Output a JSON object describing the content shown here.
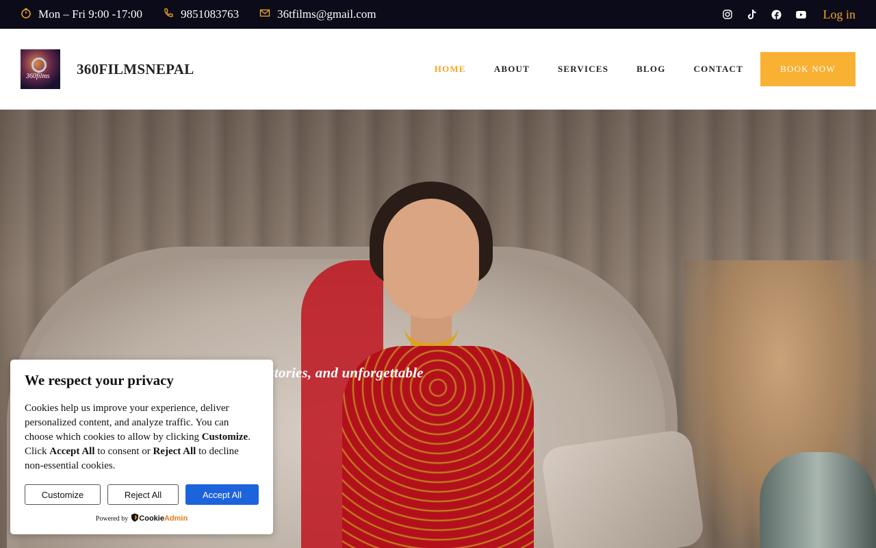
{
  "topbar": {
    "hours": "Mon – Fri 9:00 -17:00",
    "phone": "9851083763",
    "email": "36tfilms@gmail.com",
    "social_icons": [
      "instagram-icon",
      "tiktok-icon",
      "facebook-icon",
      "youtube-icon"
    ],
    "login": "Log in"
  },
  "header": {
    "logo_text": "360films",
    "brand": "360FILMSNEPAL",
    "nav": [
      {
        "label": "HOME",
        "active": true
      },
      {
        "label": "ABOUT",
        "active": false
      },
      {
        "label": "SERVICES",
        "active": false
      },
      {
        "label": "BLOG",
        "active": false
      },
      {
        "label": "CONTACT",
        "active": false
      }
    ],
    "book_button": "BOOK NOW"
  },
  "hero": {
    "text": "ve stories, and unforgettable"
  },
  "cookie": {
    "title": "We respect your privacy",
    "body_1": "Cookies help us improve your experience, deliver personalized content, and analyze traffic. You can choose which cookies to allow by clicking ",
    "body_customize": "Customize",
    "body_2": ". Click ",
    "body_accept": "Accept All",
    "body_3": " to consent or ",
    "body_reject": "Reject All",
    "body_4": " to decline non-essential cookies.",
    "btn_customize": "Customize",
    "btn_reject": "Reject All",
    "btn_accept": "Accept All",
    "powered_by": "Powered by",
    "brand_cookie": "Cookie",
    "brand_admin": "Admin"
  },
  "colors": {
    "topbar_bg": "#0b0b1a",
    "accent": "#f5a623",
    "book_button_bg": "#f9b133",
    "accept_button_bg": "#1d63dc"
  }
}
